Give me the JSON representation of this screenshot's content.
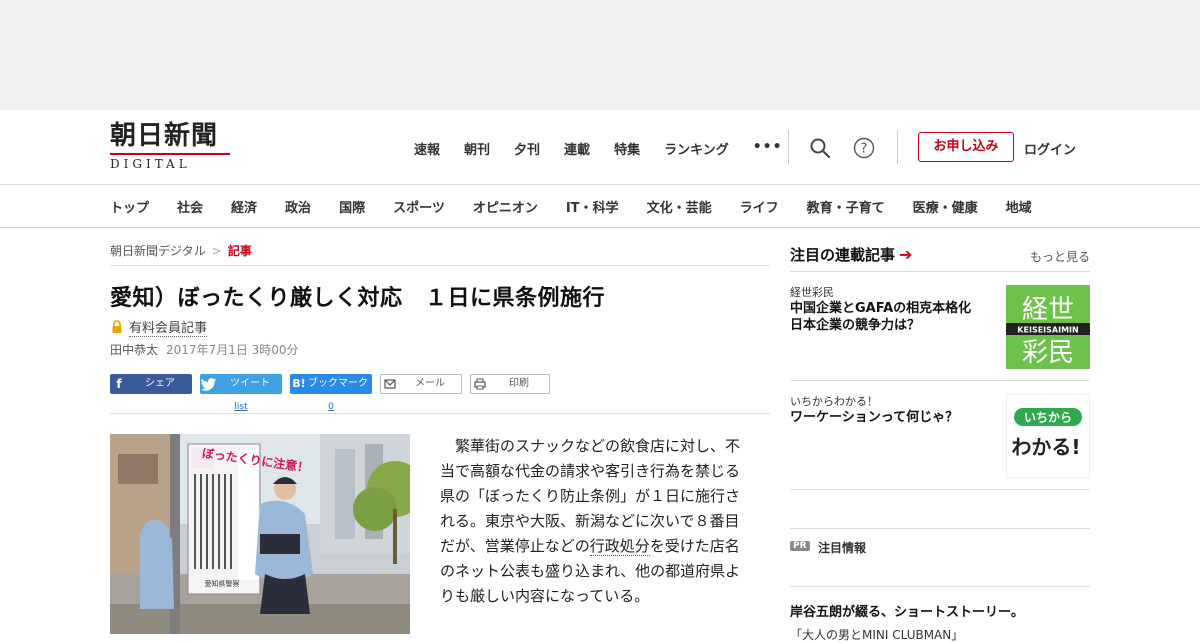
{
  "logo": {
    "main": "朝日新聞",
    "sub": "DIGITAL"
  },
  "topnav": [
    "速報",
    "朝刊",
    "夕刊",
    "連載",
    "特集",
    "ランキング"
  ],
  "topnav_more": "•••",
  "header": {
    "signup": "お申し込み",
    "login": "ログイン"
  },
  "catnav": [
    "トップ",
    "社会",
    "経済",
    "政治",
    "国際",
    "スポーツ",
    "オピニオン",
    "IT・科学",
    "文化・芸能",
    "ライフ",
    "教育・子育て",
    "医療・健康",
    "地域"
  ],
  "breadcrumb": {
    "home": "朝日新聞デジタル",
    "sep": ">",
    "current": "記事"
  },
  "article": {
    "title": "愛知）ぼったくり厳しく対応　１日に県条例施行",
    "paid_label": "有料会員記事",
    "author": "田中恭太",
    "date": "2017年7月1日 3時00分",
    "body_pre": "　繁華街のスナックなどの飲食店に対し、不当で高額な代金の請求や客引き行為を禁じる県の「ぼったくり防止条例」が１日に施行される。東京や大阪、新潟などに次いで８番目だが、営業停止などの",
    "body_link": "行政処分",
    "body_post": "を受けた店名のネット公表も盛り込まれ、他の都道府県よりも厳しい内容になっている。"
  },
  "share": {
    "facebook": "シェア",
    "twitter": "ツイート",
    "twitter_count": "list",
    "hatena": "ブックマーク",
    "hatena_icon": "B!",
    "hatena_count": "0",
    "mail": "メール",
    "print": "印刷"
  },
  "photo": {
    "poster_headline": "ぼったくりに注意！",
    "poster_footer": "愛知県警察"
  },
  "sidebar": {
    "heading": "注目の連載記事",
    "heading_arrow": "➔",
    "more": "もっと見る",
    "cards": [
      {
        "kicker": "経世彩民",
        "title": "中国企業とGAFAの相克本格化　日本企業の競争力は？",
        "thumb_top": "経世",
        "thumb_mid": "KEISEISAIMIN",
        "thumb_bottom": "彩民"
      },
      {
        "kicker": "いちからわかる！",
        "title": "ワーケーションって何じゃ？",
        "thumb_top": "いちから",
        "thumb_bottom": "わかる!"
      }
    ],
    "pr_badge": "PR",
    "pr_label": "注目情報",
    "pr_title": "岸谷五朗が綴る、ショートストーリー。",
    "pr_sub": "「大人の男とMINI CLUBMAN」"
  },
  "colors": {
    "accent": "#c4001b",
    "facebook": "#3b5a9a",
    "twitter": "#3fa0e2",
    "hatena": "#2a8be6",
    "keisei_green": "#6cc24a"
  }
}
